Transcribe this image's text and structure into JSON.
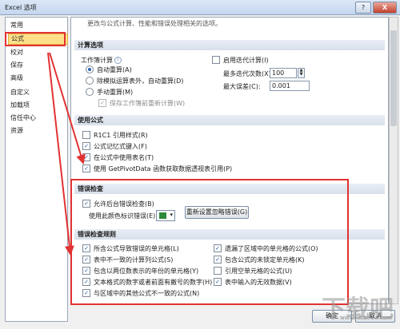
{
  "window": {
    "title": "Excel 选项",
    "help": "?",
    "close": "X"
  },
  "sidebar": {
    "items": [
      {
        "label": "常用"
      },
      {
        "label": "公式",
        "active": true
      },
      {
        "label": "校对"
      },
      {
        "label": "保存"
      },
      {
        "label": "高级"
      },
      {
        "label": "自定义"
      },
      {
        "label": "加载项"
      },
      {
        "label": "信任中心"
      },
      {
        "label": "资源"
      }
    ]
  },
  "header_text": "更改与公式计算、性能和错误处理相关的选项。",
  "calc": {
    "title": "计算选项",
    "workbook_calc": "工作簿计算",
    "radio_auto": "自动重算(A)",
    "radio_auto_except": "除模拟运算表外，自动重算(D)",
    "radio_manual": "手动重算(M)",
    "save_recalc": "保存工作簿前重新计算(W)",
    "iter_enable": "启用迭代计算(I)",
    "max_iter_label": "最多迭代次数(X):",
    "max_iter_value": "100",
    "max_change_label": "最大误差(C):",
    "max_change_value": "0.001"
  },
  "using": {
    "title": "使用公式",
    "r1c1": "R1C1 引用样式(R)",
    "autocomplete": "公式记忆式键入(F)",
    "table_names": "在公式中使用表名(T)",
    "getpivot": "使用 GetPivotData 函数获取数据透视表引用(P)"
  },
  "error_check": {
    "title": "错误检查",
    "enable_bg": "允许后台错误检查(B)",
    "color_label": "使用此颜色标识错误(E):",
    "reset_btn": "重新设置忽略错误(G)"
  },
  "rules": {
    "title": "错误检查规则",
    "left": [
      "所含公式导致错误的单元格(L)",
      "表中不一致的计算列公式(S)",
      "包含以两位数表示的年份的单元格(Y)",
      "文本格式的数字或者前面有撇号的数字(H)",
      "与区域中的其他公式不一致的公式(N)"
    ],
    "right": [
      "遗漏了区域中的单元格的公式(O)",
      "包含公式的未锁定单元格(K)",
      "引用空单元格的公式(U)",
      "表中输入的无效数据(V)"
    ]
  },
  "footer": {
    "ok": "确定",
    "cancel": "取消"
  },
  "watermark": {
    "big": "下载吧",
    "small": "www.xiazaiba.com"
  },
  "colors": {
    "highlight": "#e23232",
    "active_item": "#ffe08a"
  }
}
